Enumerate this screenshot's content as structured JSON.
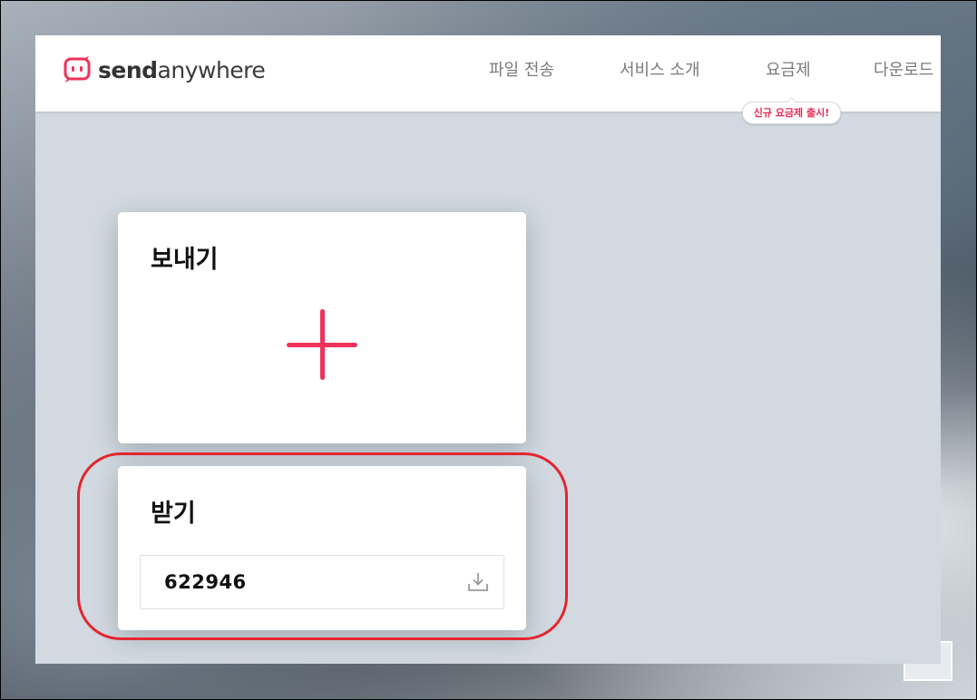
{
  "brand": {
    "name_bold": "send",
    "name_rest": "anywhere",
    "accent_color": "#f0325a",
    "logo_icon": "chat-bubble-arrows-icon"
  },
  "nav": {
    "items": [
      {
        "label": "파일 전송"
      },
      {
        "label": "서비스 소개"
      },
      {
        "label": "요금제"
      },
      {
        "label": "다운로드"
      }
    ],
    "badge": "신규 요금제 출시!"
  },
  "send": {
    "title": "보내기",
    "add_icon": "plus-icon"
  },
  "receive": {
    "title": "받기",
    "code_value": "622946",
    "download_icon": "download-icon"
  },
  "annotation": {
    "highlight_color": "#e3262f"
  }
}
